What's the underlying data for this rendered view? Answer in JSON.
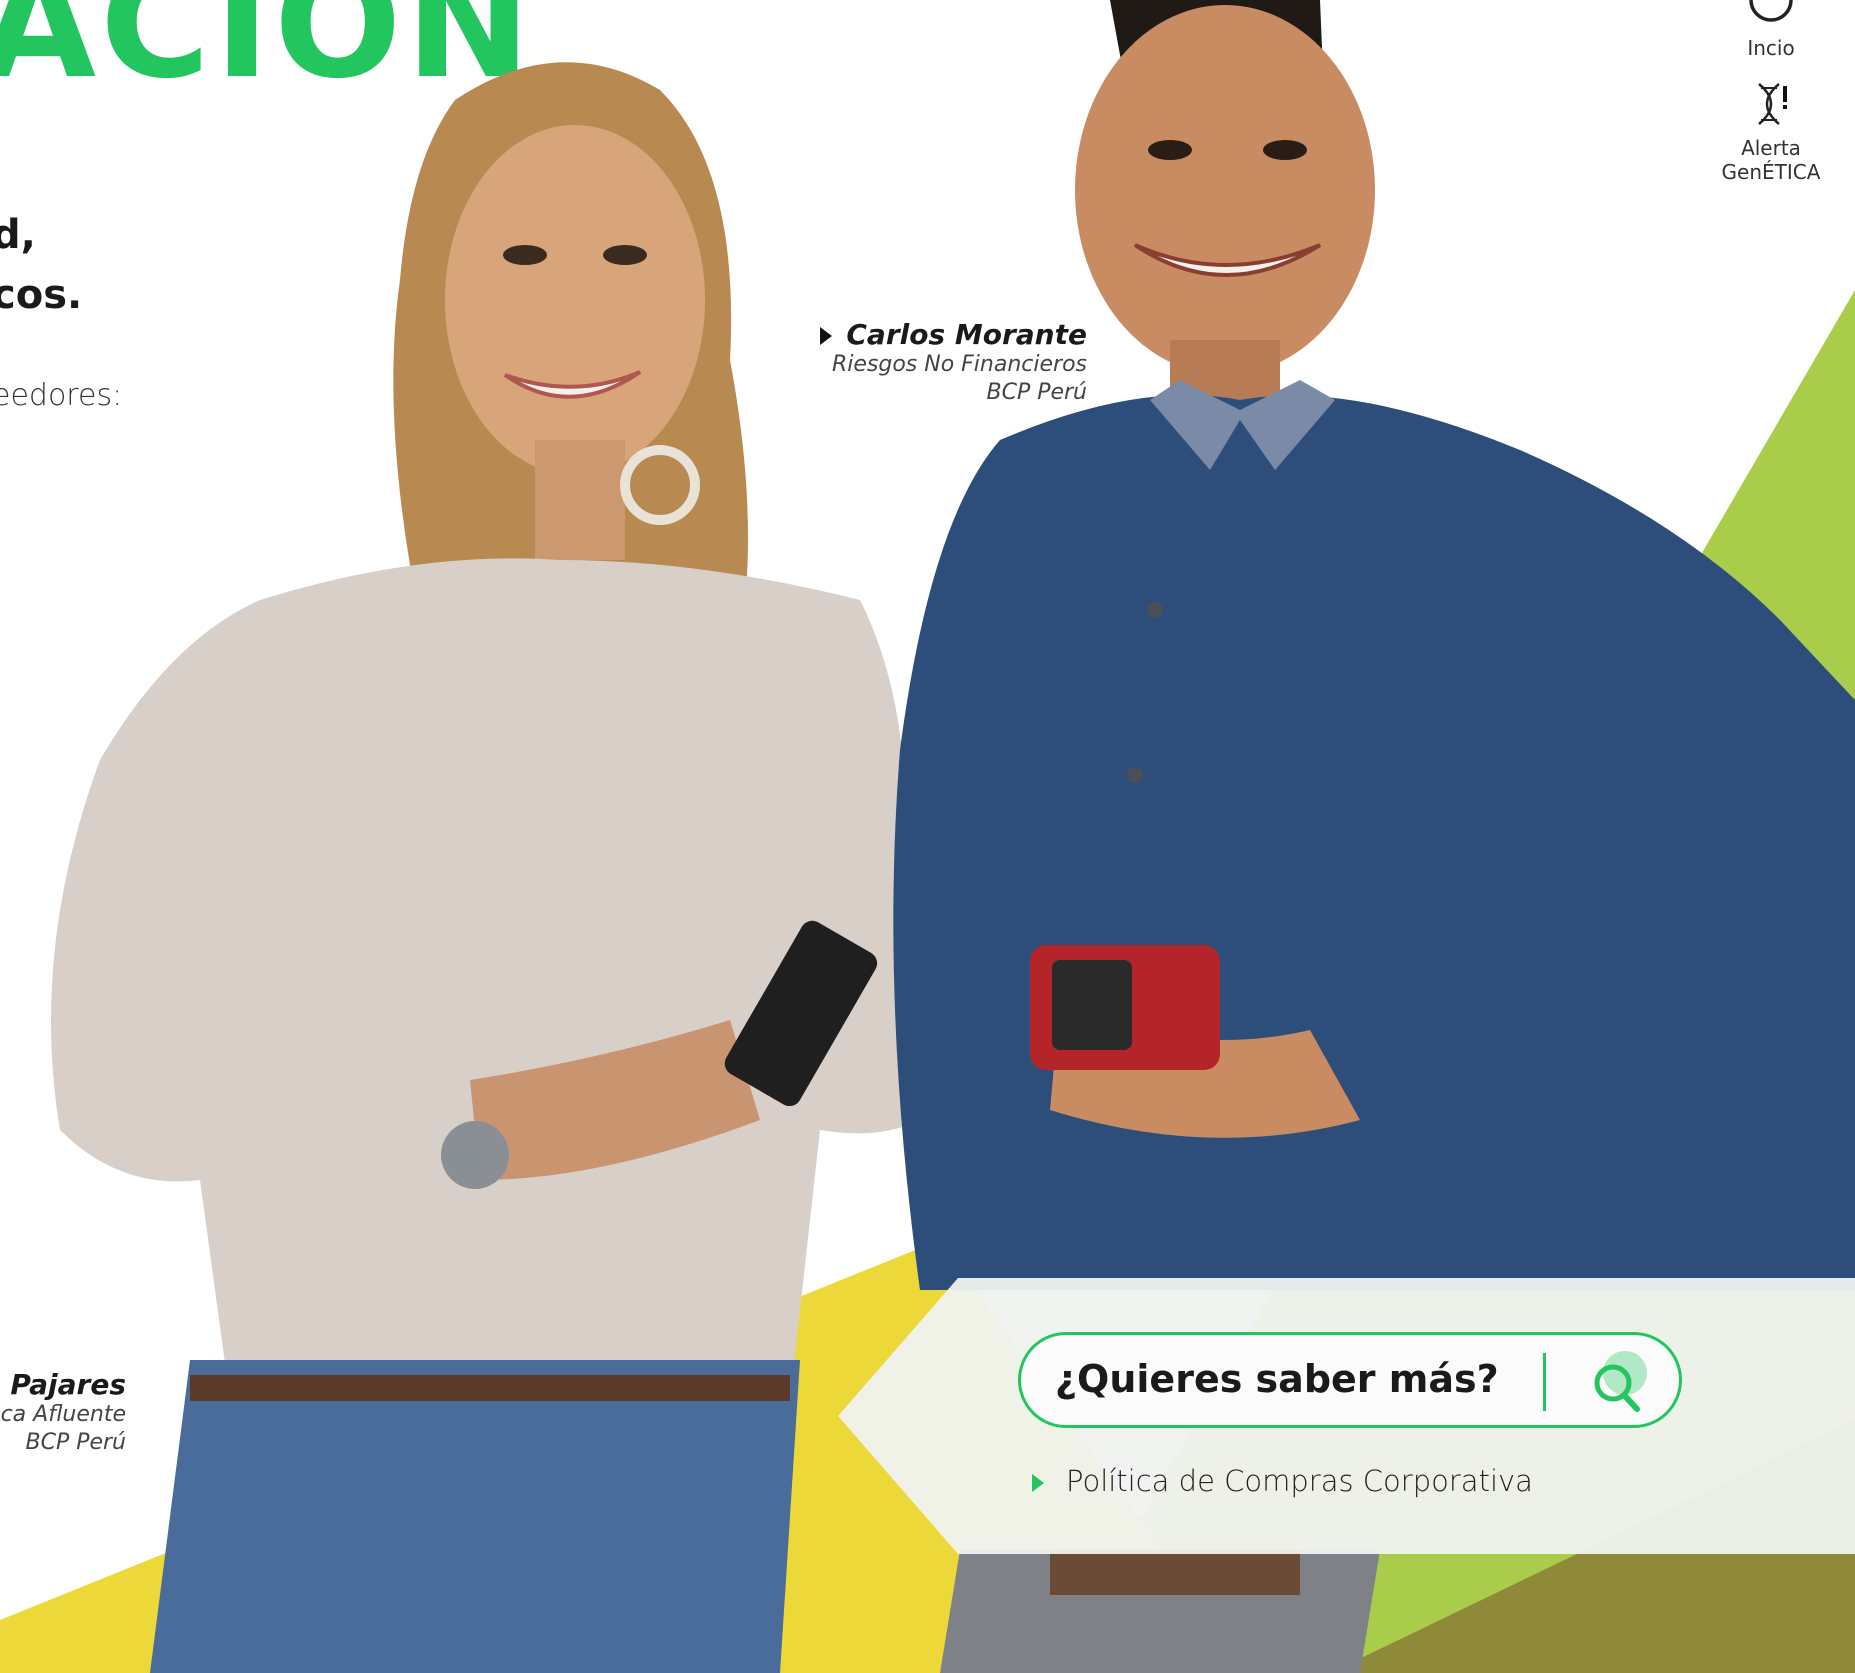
{
  "heading": "ACIÓN",
  "subheading_lines": [
    "d,",
    "cos."
  ],
  "body_fragment": "eedores:",
  "nav": {
    "home_label": "Incio",
    "alert_label_1": "Alerta",
    "alert_label_2": "GenÉTICA"
  },
  "captions": {
    "person_right": {
      "name": "Carlos Morante",
      "role_1": "Riesgos No Financieros",
      "role_2": "BCP Perú"
    },
    "person_left": {
      "name": "e Pajares",
      "role_1": "nca Afluente",
      "role_2": "BCP Perú"
    }
  },
  "search": {
    "label": "¿Quieres saber más?",
    "link": "Política de Compras Corporativa"
  },
  "colors": {
    "brand_green": "#22c55e",
    "lime": "#a9cc4a",
    "yellow": "#ecd838",
    "olive": "#8f8a3a"
  }
}
